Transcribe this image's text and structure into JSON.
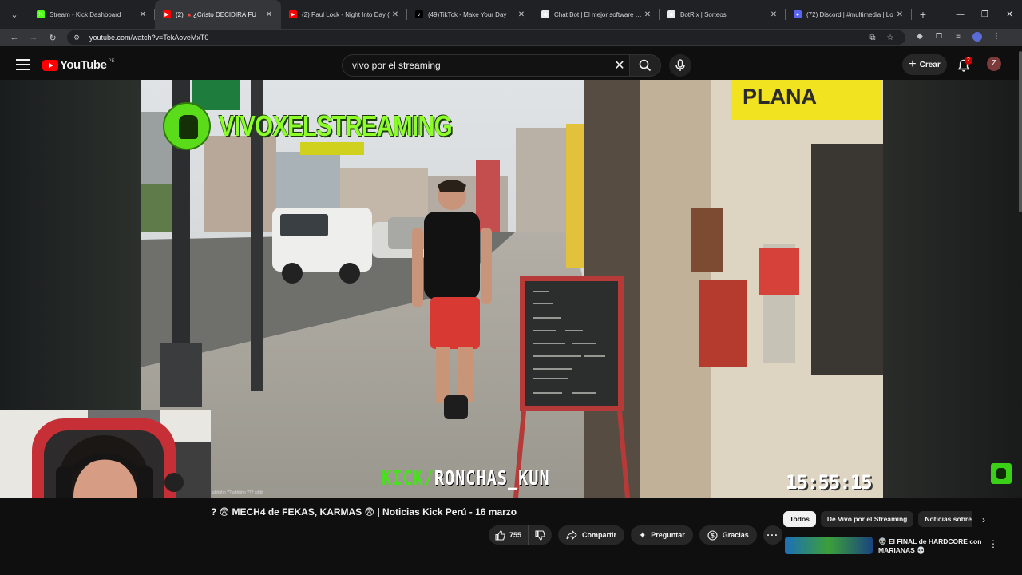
{
  "browser": {
    "tabs": [
      {
        "title": "Stream - Kick Dashboard",
        "favicon": "kick-icon",
        "color": "#53fc18",
        "glyph": "K"
      },
      {
        "title": "(2) 🔺¿Cristo DECIDIRÁ FU",
        "favicon": "youtube-icon",
        "color": "#ff0000",
        "glyph": "▶",
        "active": true
      },
      {
        "title": "(2) Paul Lock - Night Into Day (",
        "favicon": "youtube-icon",
        "color": "#ff0000",
        "glyph": "▶"
      },
      {
        "title": "(49)TikTok - Make Your Day",
        "favicon": "tiktok-icon",
        "color": "#000000",
        "glyph": "♪"
      },
      {
        "title": "Chat Bot | El mejor software pa",
        "favicon": "chatbot-icon",
        "color": "#e8eaed",
        "glyph": "◆"
      },
      {
        "title": "BotRix | Sorteos",
        "favicon": "botrix-icon",
        "color": "#e8eaed",
        "glyph": "◆"
      },
      {
        "title": "(72) Discord | #multimedia | Lo",
        "favicon": "discord-icon",
        "color": "#5865f2",
        "glyph": "●"
      }
    ],
    "url": "youtube.com/watch?v=TekAoveMxT0"
  },
  "youtube": {
    "logo_text": "YouTube",
    "country_code": "PE",
    "search_value": "vivo por el streaming",
    "create_label": "Crear",
    "notification_count": "2",
    "avatar_letter": "Z"
  },
  "video": {
    "overlay_title": "VIVOXELSTREAMING",
    "overlay_kick": "KICK/",
    "overlay_channel": "RONCHAS_KUN",
    "overlay_clock": "15:55:15",
    "sign_text": "PLANA",
    "webcam_caption": "ahhhhh ?? ahhhhh ??? xddd"
  },
  "info": {
    "title": "? 😨 MECH4 de FEKAS, KARMAS 😨 | Noticias Kick Perú - 16 marzo",
    "like_count": "755",
    "share_label": "Compartir",
    "ask_label": "Preguntar",
    "thanks_label": "Gracias",
    "chips": [
      {
        "label": "Todos",
        "active": true
      },
      {
        "label": "De Vivo por el Streaming",
        "active": false
      },
      {
        "label": "Noticias sobre",
        "active": false
      }
    ],
    "rec_title": "👽 El FINAL de HARDCORE con MARIANAS 💀"
  }
}
